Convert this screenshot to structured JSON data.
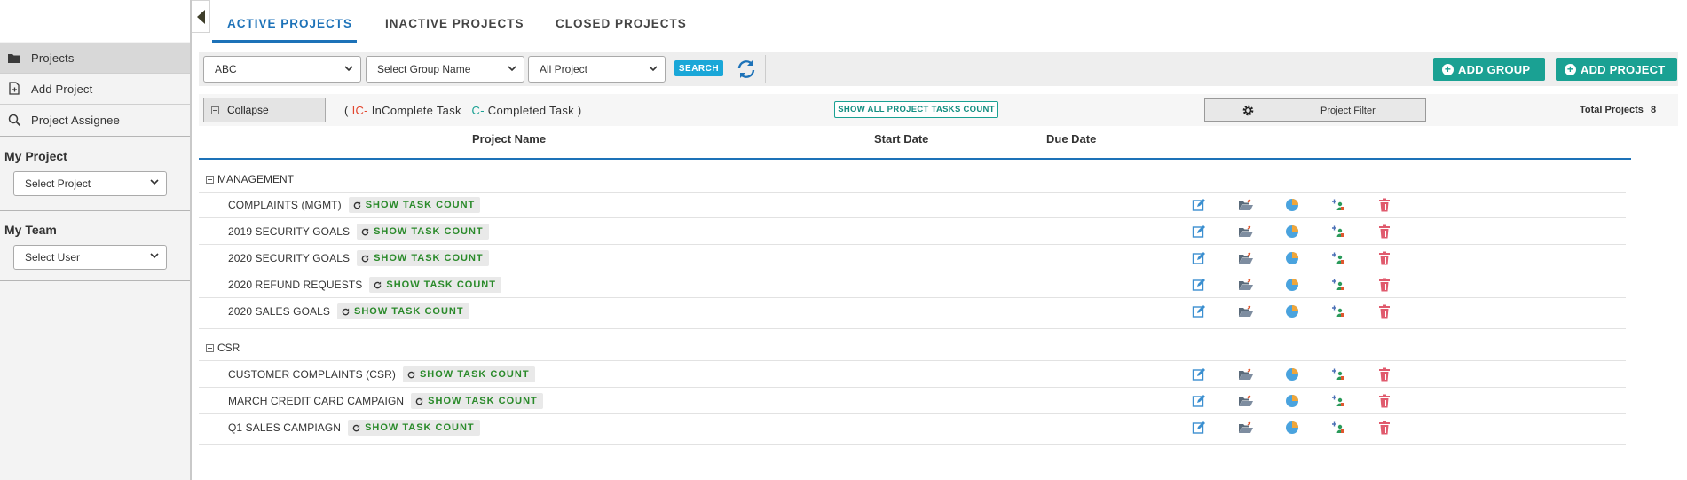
{
  "sidebar": {
    "nav": [
      {
        "label": "Projects",
        "icon": "folder-icon",
        "active": true
      },
      {
        "label": "Add Project",
        "icon": "add-file-icon"
      },
      {
        "label": "Project Assignee",
        "icon": "search-icon"
      }
    ],
    "my_project": {
      "title": "My Project",
      "select": "Select Project"
    },
    "my_team": {
      "title": "My Team",
      "select": "Select User"
    }
  },
  "tabs": [
    {
      "label": "ACTIVE PROJECTS",
      "active": true
    },
    {
      "label": "INACTIVE PROJECTS"
    },
    {
      "label": "CLOSED PROJECTS"
    }
  ],
  "toolbar": {
    "company_select": "ABC",
    "group_select": "Select Group Name",
    "project_select": "All Project",
    "search_label": "SEARCH",
    "add_group_label": "ADD GROUP",
    "add_project_label": "ADD PROJECT"
  },
  "info": {
    "collapse_label": "Collapse",
    "legend_open": "(",
    "ic_code": "IC-",
    "ic_text": " InComplete Task",
    "c_code": "C-",
    "c_text": " Completed Task )",
    "show_all_label": "SHOW ALL PROJECT TASKS COUNT",
    "filter_label": "Project Filter",
    "total_label": "Total Projects",
    "total_value": "8"
  },
  "columns": {
    "name": "Project Name",
    "start": "Start Date",
    "due": "Due Date"
  },
  "task_count_label": "SHOW TASK COUNT",
  "groups": [
    {
      "name": "MANAGEMENT",
      "projects": [
        "COMPLAINTS (MGMT)",
        "2019 SECURITY GOALS",
        "2020 SECURITY GOALS",
        "2020 REFUND REQUESTS",
        "2020 SALES GOALS"
      ]
    },
    {
      "name": "CSR",
      "projects": [
        "CUSTOMER COMPLAINTS (CSR)",
        "MARCH CREDIT CARD CAMPAIGN",
        "Q1 SALES CAMPIAGN"
      ]
    }
  ],
  "row_action_icons": [
    "edit-icon",
    "open-folder-icon",
    "pie-chart-icon",
    "assign-user-icon",
    "trash-icon"
  ],
  "colors": {
    "accent_blue": "#1d72b8",
    "teal": "#1aa193",
    "search_blue": "#1aa7d8",
    "incomplete_red": "#e2452d",
    "delete_red": "#e05a6d"
  }
}
